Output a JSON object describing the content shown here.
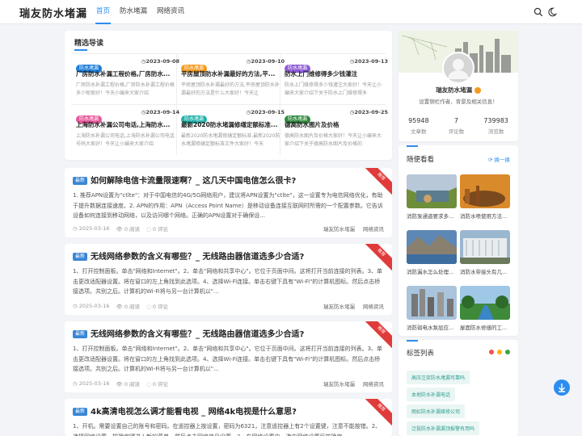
{
  "header": {
    "logo": "瑞友防水堵漏",
    "nav": [
      "首页",
      "防水堵漏",
      "网络资讯"
    ]
  },
  "featured": {
    "title": "精选导读",
    "items": [
      {
        "tag": "防水堵漏",
        "tag_color": "#1b7bd8",
        "date": "2023-09-08",
        "title": "厂房防水补漏工程价格,厂房防水...",
        "desc": "厂房防水补漏工程价格,厂房防水补漏工程价格多少呢家好！今天小编来大家介绍"
      },
      {
        "tag": "防水堵漏",
        "tag_color": "#f39a1e",
        "date": "2023-09-10",
        "title": "平房屋顶防水补漏最好的方法,平...",
        "desc": "平房屋顶防水补漏最好的方法,平房屋顶防水补漏最好的方法是什么大家好！今天让"
      },
      {
        "tag": "防水堵漏",
        "tag_color": "#8e5bd6",
        "date": "2023-09-13",
        "title": "防水上门维修得多少钱灌注",
        "desc": "防水上门维修得多少钱灌注大家好！今天让小编来大家介绍下关于防水上门维修得多"
      },
      {
        "tag": "防水堵漏",
        "tag_color": "#e8579a",
        "date": "2023-09-14",
        "title": "上海防水补漏公司电话,上海防水...",
        "desc": "上海防水补漏公司电话,上海防水补漏公司电话号码大家好！今天让小编来大家介绍"
      },
      {
        "tag": "防水堵漏",
        "tag_color": "#20b2aa",
        "date": "2023-09-15",
        "title": "最新2020防水堵漏修缮定额标准...",
        "desc": "最新2020防水堵漏修缮定额标准,最新2020防水堵漏修缮定额标准文件大家好！今天"
      },
      {
        "tag": "防水堵漏",
        "tag_color": "#2e8b3e",
        "date": "2023-09-25",
        "title": "德高防水图片及价格",
        "desc": "德高防水图片及价格大家好！今天让小编来大家介绍下关于德高防水图片及价格的"
      }
    ]
  },
  "posts": [
    {
      "badge": "最新",
      "ribbon": "推荐",
      "title": "如何解除电信卡流量限速啊？_ 这几天中国电信怎么很卡?",
      "body": "1. 推荐APN设置为\"ctlte\"：对于中国电信的4G/5G网络用户，建议将APN设置为\"ctlte\"，这一设置专为电信网络优化，有助于提升数据连接速度。2. APN的作用：APN（Access Point Name）是移动设备连接互联网时所需的一个配置参数。它告诉设备如何连接到移动网络，以及访问哪个网络。正确的APN设置对于确保设...",
      "date": "2025-03-16",
      "views": "0 阅读",
      "comments": "0 评论",
      "author": "瑞友防水堵漏",
      "category": "网络资讯"
    },
    {
      "badge": "最新",
      "ribbon": "推荐",
      "title": "无线网络参数的含义有哪些？_ 无线路由器信道选多少合适?",
      "body": "1、打开控制面板。单击\"网络和Internet\"。2、单击\"网络和共享中心\"。它位于页面中间。这将打开当前连接的列表。3、单击更改适配器设置。将在窗口的左上角找到此选项。4、选择Wi-Fi连接。单击右键下具有\"Wi-Fi\"的计算机图标。然后点击桥接选项。共别之后。计算机的Wi-Fi将与另一台计算机以\"...",
      "date": "2025-03-16",
      "views": "0 阅读",
      "comments": "0 评论",
      "author": "瑞友防水堵漏",
      "category": "网络资讯"
    },
    {
      "badge": "最新",
      "ribbon": "推荐",
      "title": "无线网络参数的含义有哪些？_ 无线路由器信道选多少合适?",
      "body": "1、打开控制面板。单击\"网络和Internet\"。2、单击\"网络和共享中心\"。它位于页面中间。这将打开当前连接的列表。3、单击更改适配器设置。将在窗口的左上角找到此选项。4、选择Wi-Fi连接。单击右键下具有\"Wi-Fi\"的计算机图标。然后点击桥接选项。共别之后。计算机的Wi-Fi将与另一台计算机以\"...",
      "date": "2025-03-16",
      "views": "0 阅读",
      "comments": "0 评论",
      "author": "瑞友防水堵漏",
      "category": "网络资讯"
    },
    {
      "badge": "最新",
      "ribbon": "推荐",
      "title": "4k高清电视怎么调才能看电视 _ 网络4k电视是什么意思?",
      "body": "1、开机。需要设置自己的账号和密码。在遥控器上按设置，密码为6321，注意遥控器上有2个设置键，注意不能按错。2、选择网络设置，按确定键进入新的菜单，然后点击网络信息设置。3、在网络设置中，选中网络设置后按确定。",
      "date": "",
      "views": "",
      "comments": "",
      "author": "",
      "category": ""
    }
  ],
  "profile": {
    "name": "瑞友防水堵漏",
    "desc": "设置侧栏作者、背景及相关信息！",
    "stats": [
      {
        "value": "95948",
        "label": "文章数"
      },
      {
        "value": "7",
        "label": "评论数"
      },
      {
        "value": "739983",
        "label": "浏览数"
      }
    ]
  },
  "random": {
    "title": "随便看看",
    "refresh": "换一换",
    "items": [
      "消防泵通道要求多...",
      "消防水喷使用方法...",
      "消防漏水怎么处理...",
      "消防水带接头有几...",
      "消防弱电水泵层应...",
      "屋面防水修缮的工..."
    ]
  },
  "tags": {
    "title": "标签列表",
    "items": [
      "高压注浆防水堵漏可靠吗",
      "本地防水补漏电话",
      "雨虹防水补漏维修公司",
      "泛投防水补漏漏顶报警有用吗"
    ]
  }
}
